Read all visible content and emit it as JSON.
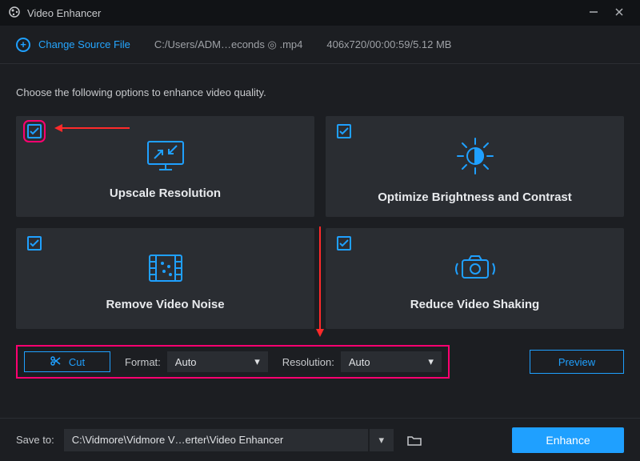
{
  "titlebar": {
    "title": "Video Enhancer"
  },
  "source": {
    "change_label": "Change Source File",
    "path": "C:/Users/ADM…econds ◎ .mp4",
    "meta": "406x720/00:00:59/5.12 MB"
  },
  "instruction": "Choose the following options to enhance video quality.",
  "cards": {
    "upscale": {
      "title": "Upscale Resolution"
    },
    "brightness": {
      "title": "Optimize Brightness and Contrast"
    },
    "denoise": {
      "title": "Remove Video Noise"
    },
    "deshake": {
      "title": "Reduce Video Shaking"
    }
  },
  "opts": {
    "cut_label": "Cut",
    "format_label": "Format:",
    "format_value": "Auto",
    "resolution_label": "Resolution:",
    "resolution_value": "Auto",
    "preview_label": "Preview"
  },
  "footer": {
    "save_label": "Save to:",
    "save_path": "C:\\Vidmore\\Vidmore V…erter\\Video Enhancer",
    "enhance_label": "Enhance"
  }
}
